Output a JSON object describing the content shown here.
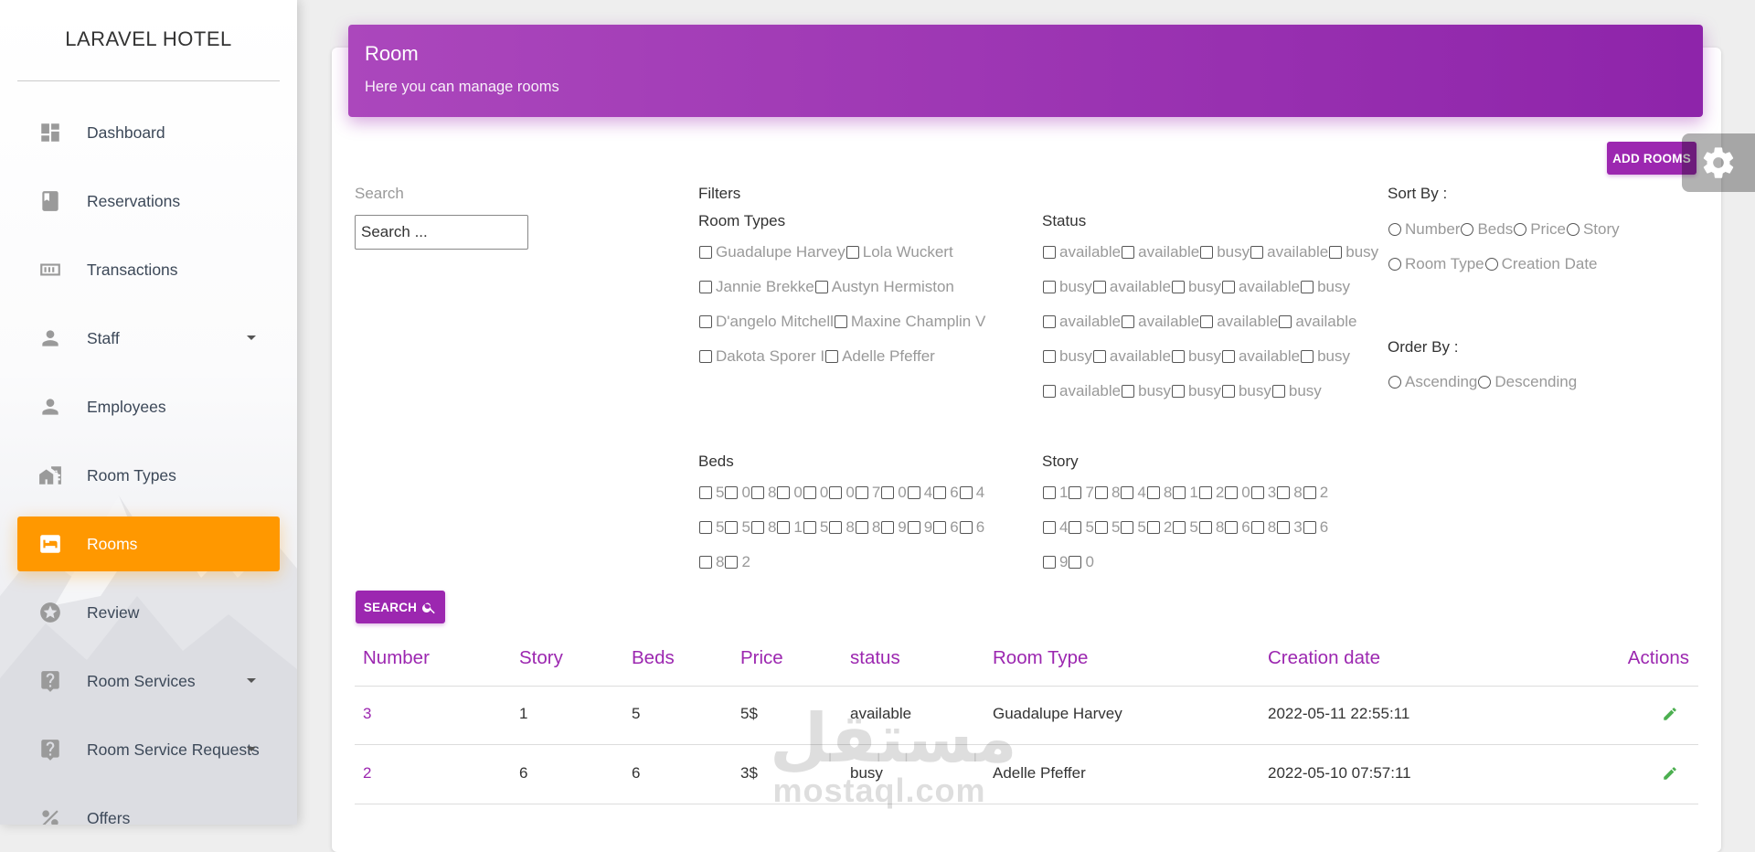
{
  "brand": "LARAVEL HOTEL",
  "accent_color": "#9c27b0",
  "active_color": "#ff9800",
  "sidebar": {
    "items": [
      {
        "label": "Dashboard",
        "icon": "dashboard-icon"
      },
      {
        "label": "Reservations",
        "icon": "book-icon"
      },
      {
        "label": "Transactions",
        "icon": "money-icon"
      },
      {
        "label": "Staff",
        "icon": "person-icon",
        "has_dropdown": true
      },
      {
        "label": "Employees",
        "icon": "person-icon"
      },
      {
        "label": "Room Types",
        "icon": "home-work-icon"
      },
      {
        "label": "Rooms",
        "icon": "bed-icon",
        "active": true
      },
      {
        "label": "Review",
        "icon": "star-icon"
      },
      {
        "label": "Room Services",
        "icon": "help-icon",
        "has_dropdown": true
      },
      {
        "label": "Room Service Requests",
        "icon": "help-icon",
        "has_dropdown": true
      },
      {
        "label": "Offers",
        "icon": "percent-icon"
      }
    ]
  },
  "header": {
    "title": "Room",
    "subtitle": "Here you can manage rooms"
  },
  "toolbar": {
    "add_rooms_label": "ADD ROOMS",
    "search_button_label": "SEARCH"
  },
  "search": {
    "label": "Search",
    "placeholder": "Search ..."
  },
  "filters": {
    "label": "Filters",
    "room_types_label": "Room Types",
    "room_types": [
      "Guadalupe Harvey",
      "Lola Wuckert",
      "Jannie Brekke",
      "Austyn Hermiston",
      "D'angelo Mitchell",
      "Maxine Champlin V",
      "Dakota Sporer I",
      "Adelle Pfeffer"
    ],
    "status_label": "Status",
    "status": [
      "available",
      "available",
      "busy",
      "available",
      "busy",
      "busy",
      "available",
      "busy",
      "available",
      "busy",
      "available",
      "available",
      "available",
      "available",
      "busy",
      "available",
      "busy",
      "available",
      "busy",
      "available",
      "busy",
      "busy",
      "busy",
      "busy"
    ],
    "beds_label": "Beds",
    "beds": [
      "5",
      "0",
      "8",
      "0",
      "0",
      "0",
      "7",
      "0",
      "4",
      "6",
      "4",
      "5",
      "5",
      "8",
      "1",
      "5",
      "8",
      "8",
      "9",
      "9",
      "6",
      "6",
      "8",
      "2"
    ],
    "story_label": "Story",
    "story": [
      "1",
      "7",
      "8",
      "4",
      "8",
      "1",
      "2",
      "0",
      "3",
      "8",
      "2",
      "4",
      "5",
      "5",
      "5",
      "2",
      "5",
      "8",
      "6",
      "8",
      "3",
      "6",
      "9",
      "0"
    ]
  },
  "sort": {
    "sort_by_label": "Sort By :",
    "sort_by": [
      "Number",
      "Beds",
      "Price",
      "Story",
      "Room Type",
      "Creation Date"
    ],
    "order_by_label": "Order By :",
    "order_by": [
      "Ascending",
      "Descending"
    ]
  },
  "table": {
    "columns": [
      "Number",
      "Story",
      "Beds",
      "Price",
      "status",
      "Room Type",
      "Creation date",
      "Actions"
    ],
    "rows": [
      {
        "number": "3",
        "story": "1",
        "beds": "5",
        "price": "5$",
        "status": "available",
        "room_type": "Guadalupe Harvey",
        "created": "2022-05-11 22:55:11"
      },
      {
        "number": "2",
        "story": "6",
        "beds": "6",
        "price": "3$",
        "status": "busy",
        "room_type": "Adelle Pfeffer",
        "created": "2022-05-10 07:57:11"
      }
    ]
  },
  "watermark": {
    "arabic": "مستقل",
    "latin": "mostaql.com"
  }
}
